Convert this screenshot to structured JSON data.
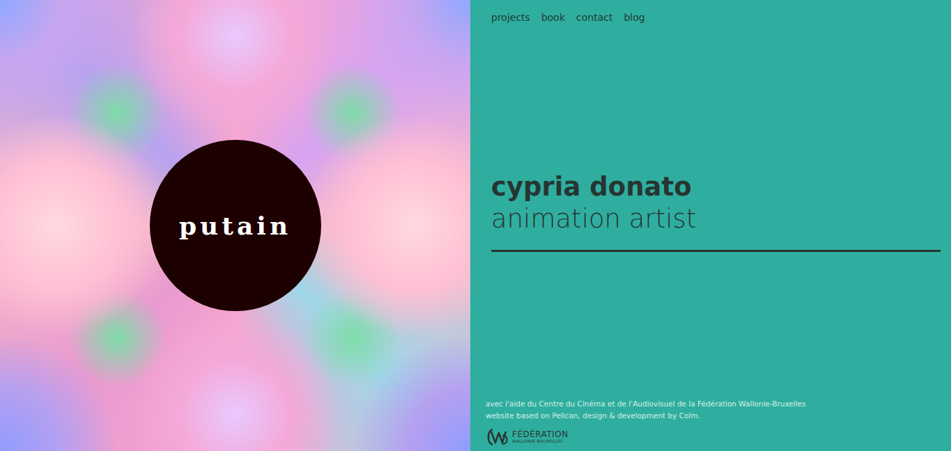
{
  "feature": {
    "title": "putain"
  },
  "nav": [
    {
      "label": "projects"
    },
    {
      "label": "book"
    },
    {
      "label": "contact"
    },
    {
      "label": "blog"
    }
  ],
  "hero": {
    "name": "cypria donato",
    "role": "animation artist"
  },
  "footer": {
    "lines": [
      "avec l'aide du Centre du Cinéma et de l'Audiovisuel de la Fédération Wallonie-Bruxelles",
      "website based on Pelican, design & development by Colm."
    ],
    "logo": {
      "title": "FÉDÉRATION",
      "subtitle": "WALLONIE-BRUXELLES"
    }
  }
}
